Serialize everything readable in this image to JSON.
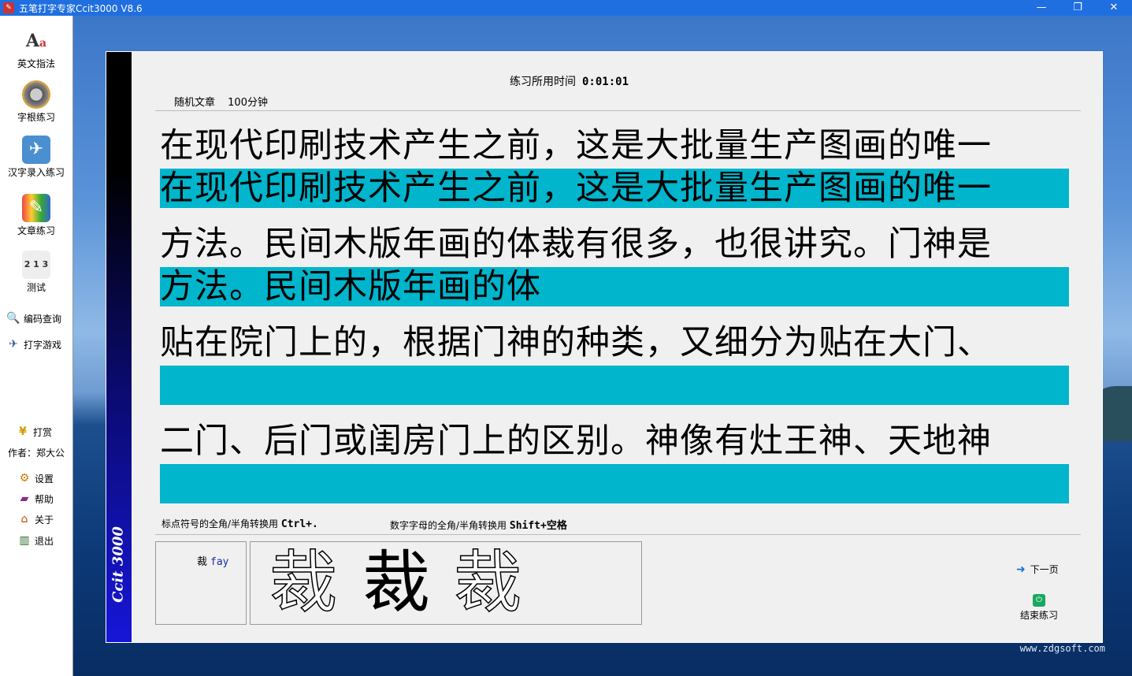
{
  "window": {
    "title": "五笔打字专家Ccit3000 V8.6"
  },
  "sidebar": {
    "big_items": [
      {
        "label": "英文指法",
        "icon": "letters-aa-icon"
      },
      {
        "label": "字根练习",
        "icon": "film-reel-icon"
      },
      {
        "label": "汉字录入练习",
        "icon": "runner-icon"
      },
      {
        "label": "文章练习",
        "icon": "pencil-cup-icon"
      },
      {
        "label": "测试",
        "icon": "podium-icon"
      }
    ],
    "tools": [
      {
        "label": "编码查询",
        "icon": "magnifier-icon"
      },
      {
        "label": "打字游戏",
        "icon": "joystick-icon"
      }
    ],
    "donate": {
      "label": "打赏",
      "icon": "yen-icon"
    },
    "author": "作者：郑大公",
    "bottom": [
      {
        "label": "设置",
        "icon": "gear-icon"
      },
      {
        "label": "帮助",
        "icon": "book-icon"
      },
      {
        "label": "关于",
        "icon": "house-icon"
      },
      {
        "label": "退出",
        "icon": "exit-icon"
      }
    ]
  },
  "practice": {
    "timer_label": "练习所用时间",
    "timer_value": "0:01:01",
    "article_type": "随机文章",
    "duration": "100分钟",
    "lines": [
      {
        "source": "在现代印刷技术产生之前，这是大批量生产图画的唯一",
        "typed": "在现代印刷技术产生之前，这是大批量生产图画的唯一"
      },
      {
        "source": "方法。民间木版年画的体裁有很多，也很讲究。门神是",
        "typed": "方法。民间木版年画的体"
      },
      {
        "source": "贴在院门上的，根据门神的种类，又细分为贴在大门、",
        "typed": ""
      },
      {
        "source": "二门、后门或闺房门上的区别。神像有灶王神、天地神",
        "typed": ""
      }
    ],
    "hint_punct_text": "标点符号的全角/半角转换用",
    "hint_punct_key": "Ctrl+.",
    "hint_alnum_text": "数字字母的全角/半角转换用",
    "hint_alnum_key": "Shift+空格",
    "current_char": "裁",
    "current_code": "fay",
    "glyphs": [
      "裁",
      "裁",
      "裁"
    ],
    "next_page": "下一页",
    "end_practice": "结束练习",
    "brand": "Ccit 3000"
  },
  "watermark": "www.zdgsoft.com"
}
